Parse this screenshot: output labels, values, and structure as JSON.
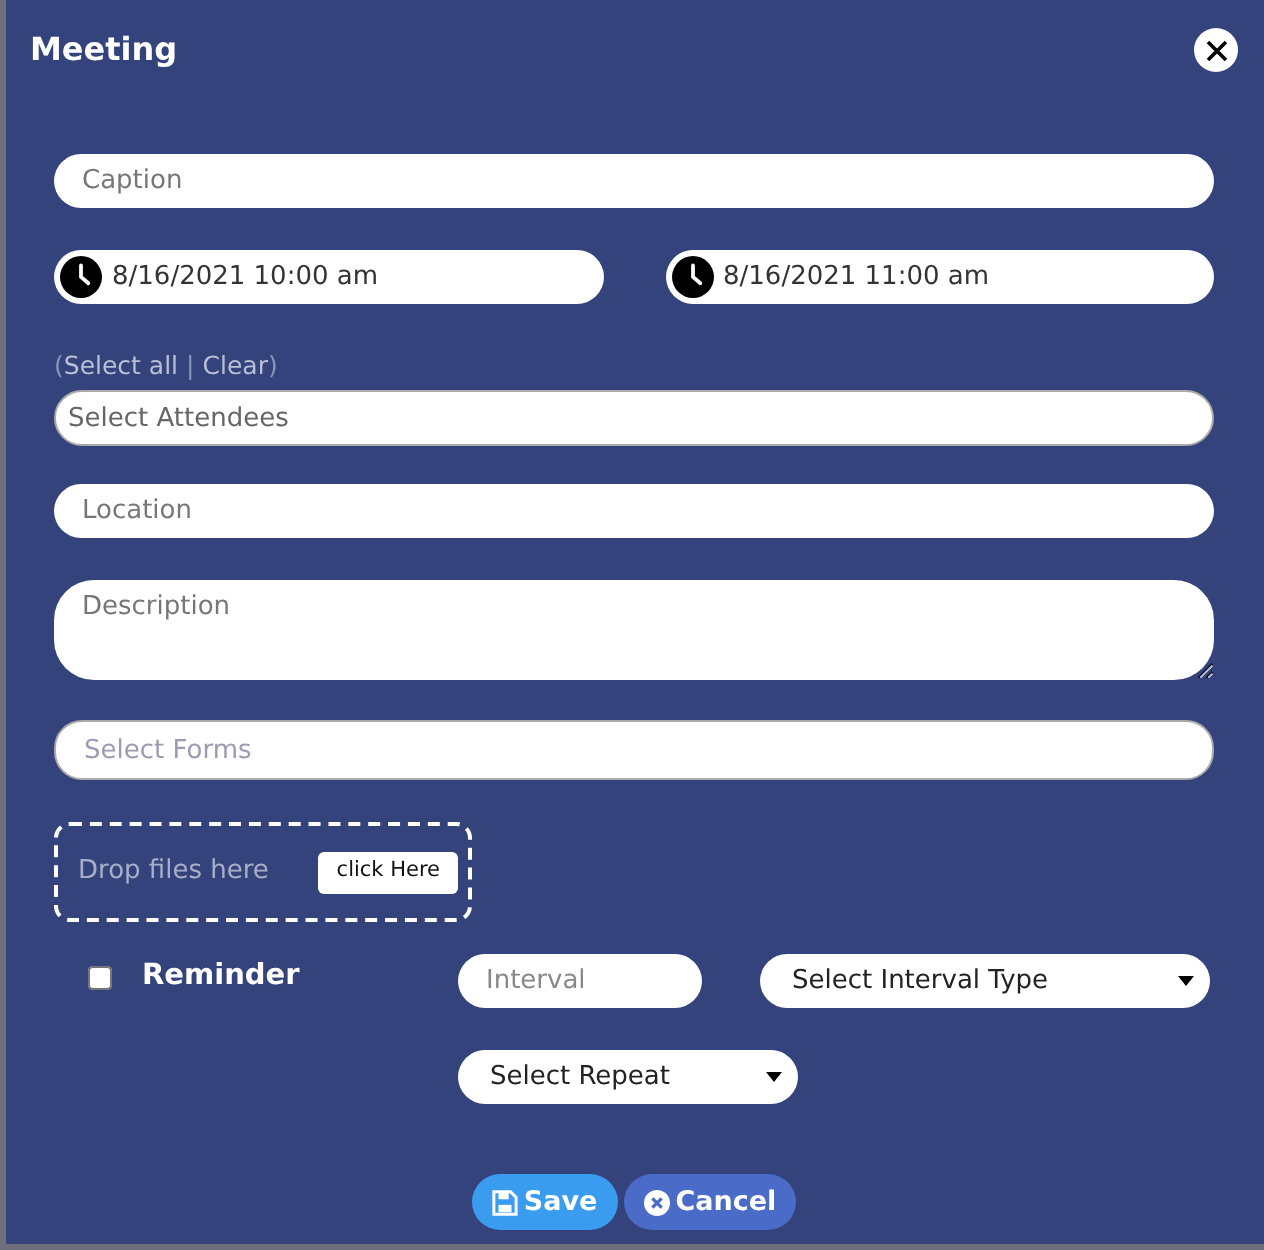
{
  "dialog": {
    "title": "Meeting"
  },
  "caption": {
    "placeholder": "Caption"
  },
  "start_time": {
    "value": "8/16/2021 10:00 am"
  },
  "end_time": {
    "value": "8/16/2021 11:00 am"
  },
  "attendee_actions": {
    "open": "(",
    "links": [
      "Select all",
      "Clear"
    ],
    "separator": "|",
    "close": ")"
  },
  "attendees": {
    "placeholder": "Select Attendees"
  },
  "location": {
    "placeholder": "Location"
  },
  "description": {
    "placeholder": "Description"
  },
  "forms": {
    "placeholder": "Select Forms"
  },
  "dropzone": {
    "text": "Drop files here",
    "button": "click Here"
  },
  "reminder": {
    "label": "Reminder",
    "checked": false,
    "interval": {
      "placeholder": "Interval"
    },
    "interval_type": {
      "value": "Select Interval Type"
    },
    "repeat": {
      "value": "Select Repeat"
    }
  },
  "buttons": [
    {
      "kind": "save",
      "label": "Save"
    },
    {
      "kind": "cancel",
      "label": "Cancel"
    }
  ]
}
